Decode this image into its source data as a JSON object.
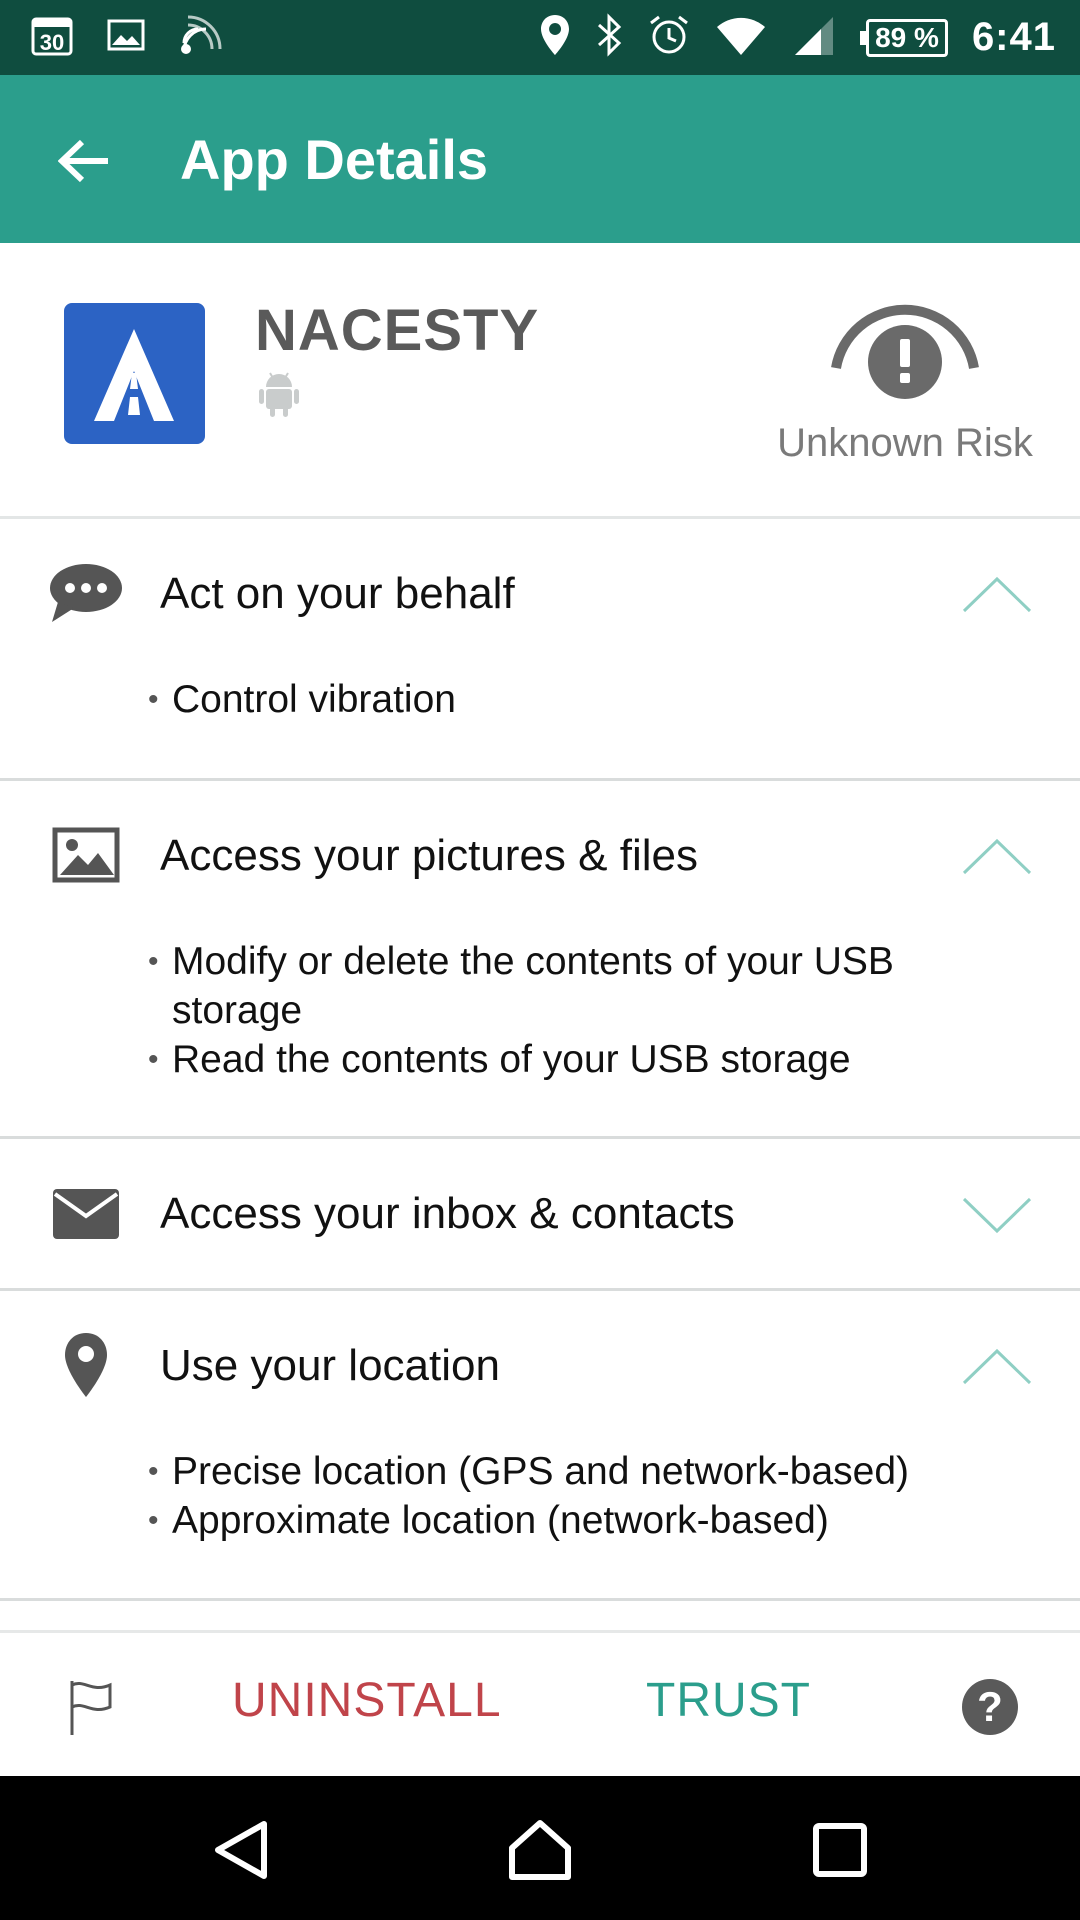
{
  "status_bar": {
    "calendar_day": "30",
    "battery": "89 %",
    "time": "6:41",
    "icons": [
      "calendar-icon",
      "gallery-icon",
      "cast-icon",
      "location-icon",
      "bluetooth-icon",
      "alarm-icon",
      "wifi-icon",
      "cell-signal-icon",
      "battery-icon"
    ]
  },
  "app_bar": {
    "title": "App Details",
    "back_icon": "arrow-left-icon"
  },
  "app": {
    "name": "NACESTY",
    "platform_icon": "android-icon",
    "risk_label": "Unknown Risk",
    "risk_icon": "exclamation-gauge-icon"
  },
  "permissions": [
    {
      "title": "Act on your behalf",
      "icon": "chat-bubble-icon",
      "expanded": true,
      "items": [
        "Control vibration"
      ]
    },
    {
      "title": "Access your pictures & files",
      "icon": "image-icon",
      "expanded": true,
      "items": [
        "Modify or delete the contents of your USB storage",
        "Read the contents of your USB storage"
      ]
    },
    {
      "title": "Access your inbox & contacts",
      "icon": "envelope-icon",
      "expanded": false,
      "items": []
    },
    {
      "title": "Use your location",
      "icon": "map-pin-icon",
      "expanded": true,
      "items": [
        "Precise location (GPS and network-based)",
        "Approximate location (network-based)"
      ]
    }
  ],
  "actions": {
    "flag_icon": "flag-icon",
    "uninstall": "UNINSTALL",
    "trust": "TRUST",
    "help": "?"
  },
  "nav": {
    "back_icon": "nav-back-icon",
    "home_icon": "nav-home-icon",
    "recents_icon": "nav-recents-icon"
  },
  "colors": {
    "status_bar": "#0f4d3f",
    "app_bar": "#2b9e8c",
    "uninstall": "#c0444a",
    "trust": "#2b9e8c",
    "app_icon": "#2c63c4"
  }
}
